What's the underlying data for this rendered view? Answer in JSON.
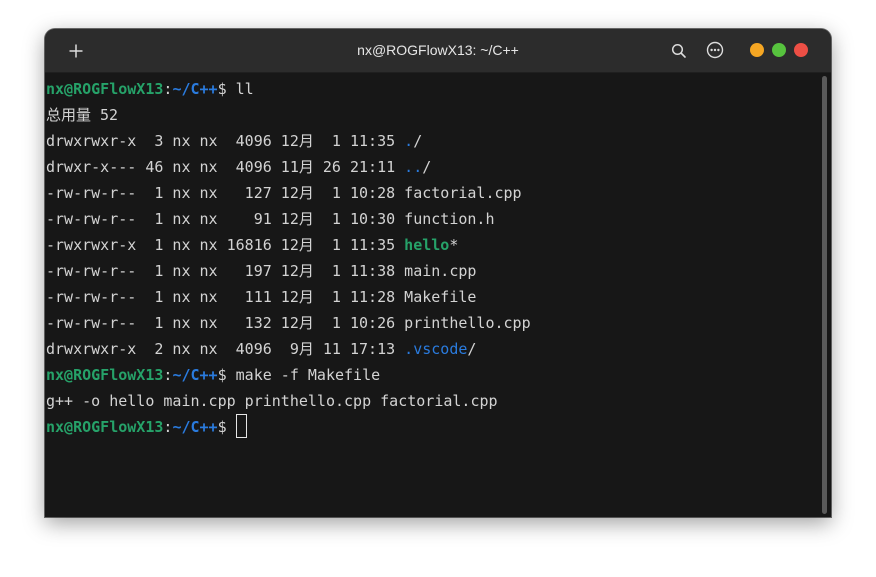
{
  "titlebar": {
    "title": "nx@ROGFlowX13: ~/C++",
    "new_tab_icon": "plus-icon",
    "search_icon": "search-icon",
    "menu_icon": "more-icon",
    "controls": {
      "minimize_color": "#f5a623",
      "maximize_color": "#57c33e",
      "close_color": "#ed4f45"
    }
  },
  "terminal": {
    "user_host": "nx@ROGFlowX13",
    "colon": ":",
    "path": "~/C++",
    "prompt_symbol": "$ ",
    "cmd1": "ll",
    "total": "总用量 52",
    "listing": [
      {
        "meta": "drwxrwxr-x  3 nx nx  4096 12月  1 11:35 ",
        "name": "./",
        "kind": "dir-dot",
        "base": ".",
        "suffix": "/"
      },
      {
        "meta": "drwxr-x--- 46 nx nx  4096 11月 26 21:11 ",
        "name": "../",
        "kind": "dir-dot",
        "base": "..",
        "suffix": "/"
      },
      {
        "meta": "-rw-rw-r--  1 nx nx   127 12月  1 10:28 ",
        "name": "factorial.cpp",
        "kind": "file"
      },
      {
        "meta": "-rw-rw-r--  1 nx nx    91 12月  1 10:30 ",
        "name": "function.h",
        "kind": "file"
      },
      {
        "meta": "-rwxrwxr-x  1 nx nx 16816 12月  1 11:35 ",
        "name": "hello*",
        "kind": "exe",
        "base": "hello",
        "suffix": "*"
      },
      {
        "meta": "-rw-rw-r--  1 nx nx   197 12月  1 11:38 ",
        "name": "main.cpp",
        "kind": "file"
      },
      {
        "meta": "-rw-rw-r--  1 nx nx   111 12月  1 11:28 ",
        "name": "Makefile",
        "kind": "file"
      },
      {
        "meta": "-rw-rw-r--  1 nx nx   132 12月  1 10:26 ",
        "name": "printhello.cpp",
        "kind": "file"
      },
      {
        "meta": "drwxrwxr-x  2 nx nx  4096  9月 11 17:13 ",
        "name": ".vscode/",
        "kind": "dir-dot",
        "base": ".vscode",
        "suffix": "/"
      }
    ],
    "cmd2": "make -f Makefile",
    "output": "g++ -o hello main.cpp printhello.cpp factorial.cpp"
  },
  "colors": {
    "user": "#26a269",
    "path": "#2a7bde",
    "text": "#d3d3d3",
    "background": "#171717"
  }
}
